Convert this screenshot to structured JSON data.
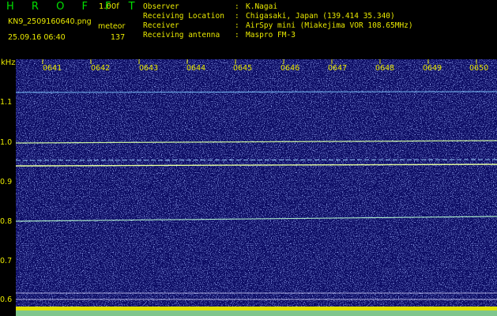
{
  "header": {
    "brand": "H R O F F T",
    "version": "1.00f",
    "filename": "KN9_2509160640.png",
    "mode_label": "meteor",
    "datetime": "25.09.16 06:40",
    "count": "137",
    "fields": [
      {
        "label": "Observer",
        "value": "K.Nagai"
      },
      {
        "label": "Receiving Location",
        "value": "Chigasaki, Japan (139.414 35.340)"
      },
      {
        "label": "Receiver",
        "value": "AirSpy mini (Miakejima VOR 108.65MHz)"
      },
      {
        "label": "Receiving antenna",
        "value": "Maspro FM-3"
      }
    ]
  },
  "axis": {
    "unit": "kHz",
    "ticks": [
      "1.1",
      "1.0",
      "0.9",
      "0.8",
      "0.7",
      "0.6"
    ]
  },
  "time_labels": [
    "0641",
    "0642",
    "0643",
    "0644",
    "0645",
    "0646",
    "0647",
    "0648",
    "0649",
    "0650"
  ],
  "colors": {
    "background": "#000000",
    "label": "#e8e800",
    "brand": "#00e000",
    "spectrogram_base": "#0a0a5a",
    "carrier_line": "#c8f0a0"
  }
}
